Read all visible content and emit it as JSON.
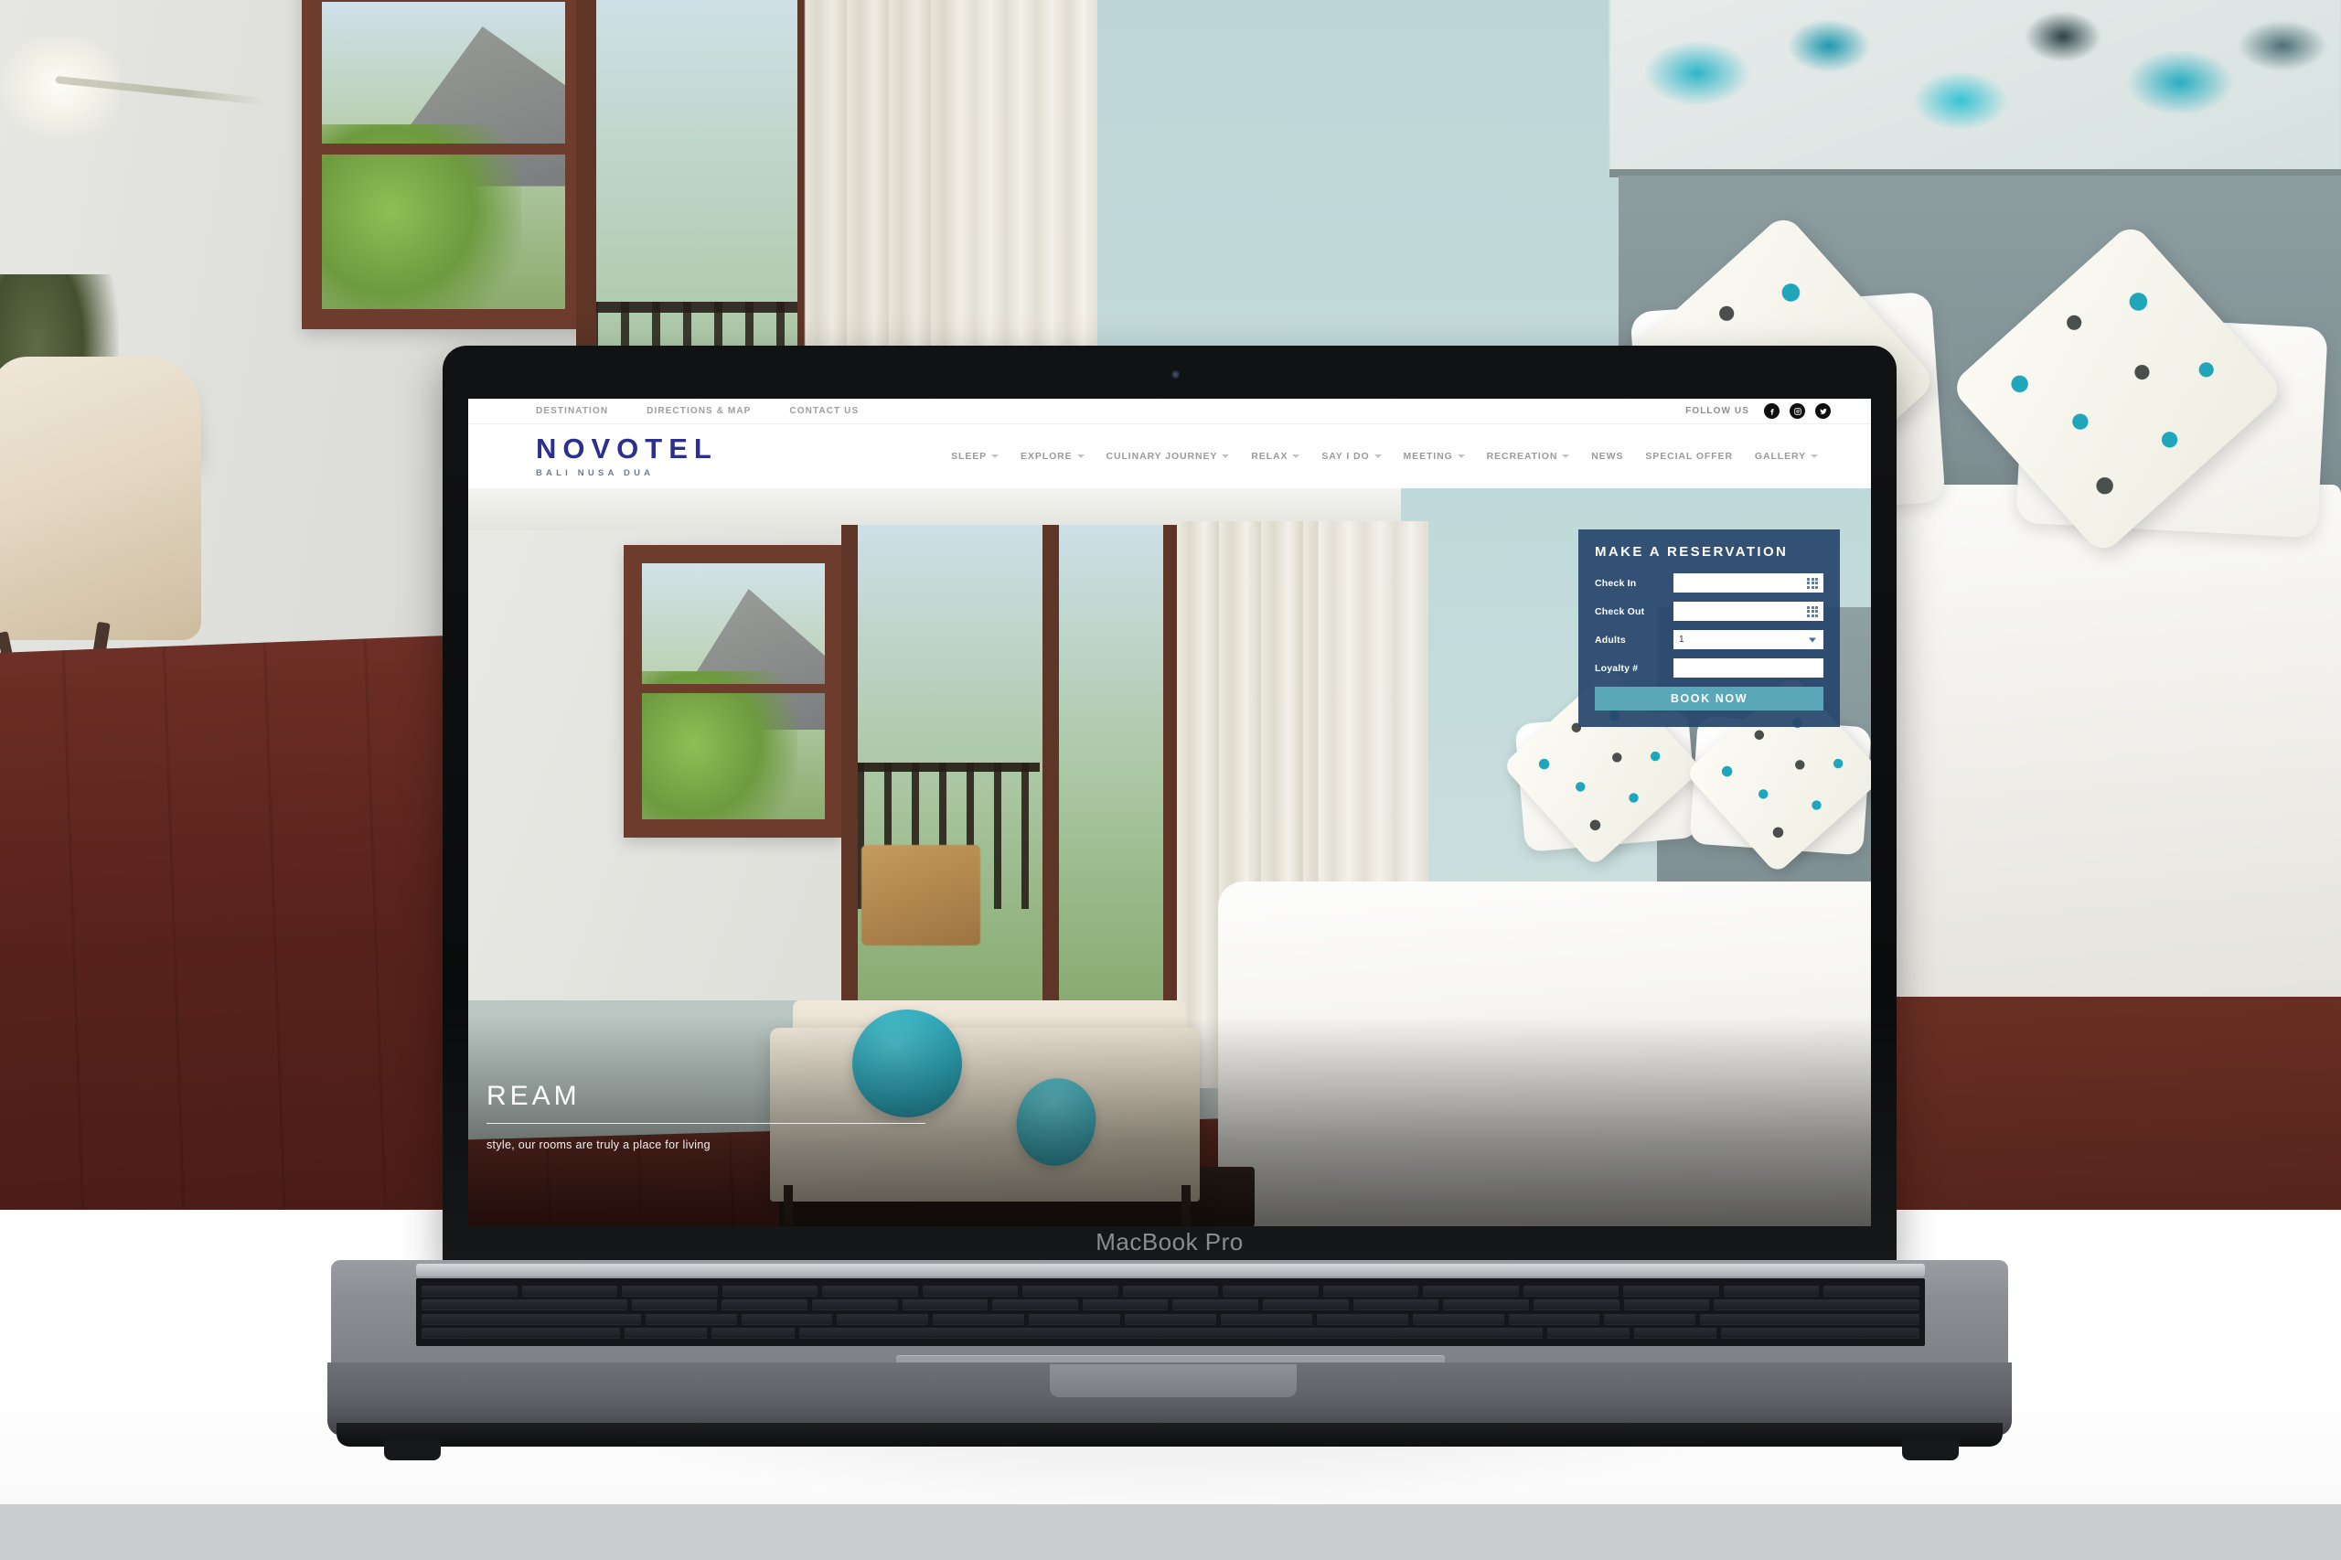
{
  "device": {
    "brand_label": "MacBook Pro"
  },
  "site": {
    "utility_nav": [
      {
        "label": "DESTINATION"
      },
      {
        "label": "DIRECTIONS & MAP"
      },
      {
        "label": "CONTACT US"
      }
    ],
    "follow": {
      "label": "FOLLOW US",
      "socials": [
        {
          "name": "facebook",
          "icon": "facebook-icon"
        },
        {
          "name": "instagram",
          "icon": "instagram-icon"
        },
        {
          "name": "twitter",
          "icon": "twitter-icon"
        }
      ]
    },
    "logo": {
      "brand": "NOVOTEL",
      "location": "BALI NUSA DUA",
      "brand_color": "#2b2f8f",
      "location_color": "#6d7a93"
    },
    "main_nav": [
      {
        "label": "SLEEP",
        "has_dropdown": true
      },
      {
        "label": "EXPLORE",
        "has_dropdown": true
      },
      {
        "label": "CULINARY JOURNEY",
        "has_dropdown": true
      },
      {
        "label": "RELAX",
        "has_dropdown": true
      },
      {
        "label": "SAY I DO",
        "has_dropdown": true
      },
      {
        "label": "MEETING",
        "has_dropdown": true
      },
      {
        "label": "RECREATION",
        "has_dropdown": true
      },
      {
        "label": "NEWS",
        "has_dropdown": false
      },
      {
        "label": "SPECIAL OFFER",
        "has_dropdown": false
      },
      {
        "label": "GALLERY",
        "has_dropdown": true
      }
    ],
    "hero": {
      "title": "REAM",
      "subtitle": "style, our rooms are truly a place for living"
    },
    "reservation": {
      "title": "MAKE A RESERVATION",
      "panel_color": "#27466c",
      "button_color": "#5aa7b8",
      "fields": [
        {
          "label": "Check In",
          "value": "",
          "type": "date",
          "icon": "calendar-icon"
        },
        {
          "label": "Check Out",
          "value": "",
          "type": "date",
          "icon": "calendar-icon"
        },
        {
          "label": "Adults",
          "value": "1",
          "type": "select",
          "icon": "chevron-down-icon"
        },
        {
          "label": "Loyalty #",
          "value": "",
          "type": "text",
          "icon": ""
        }
      ],
      "submit_label": "BOOK NOW"
    }
  }
}
